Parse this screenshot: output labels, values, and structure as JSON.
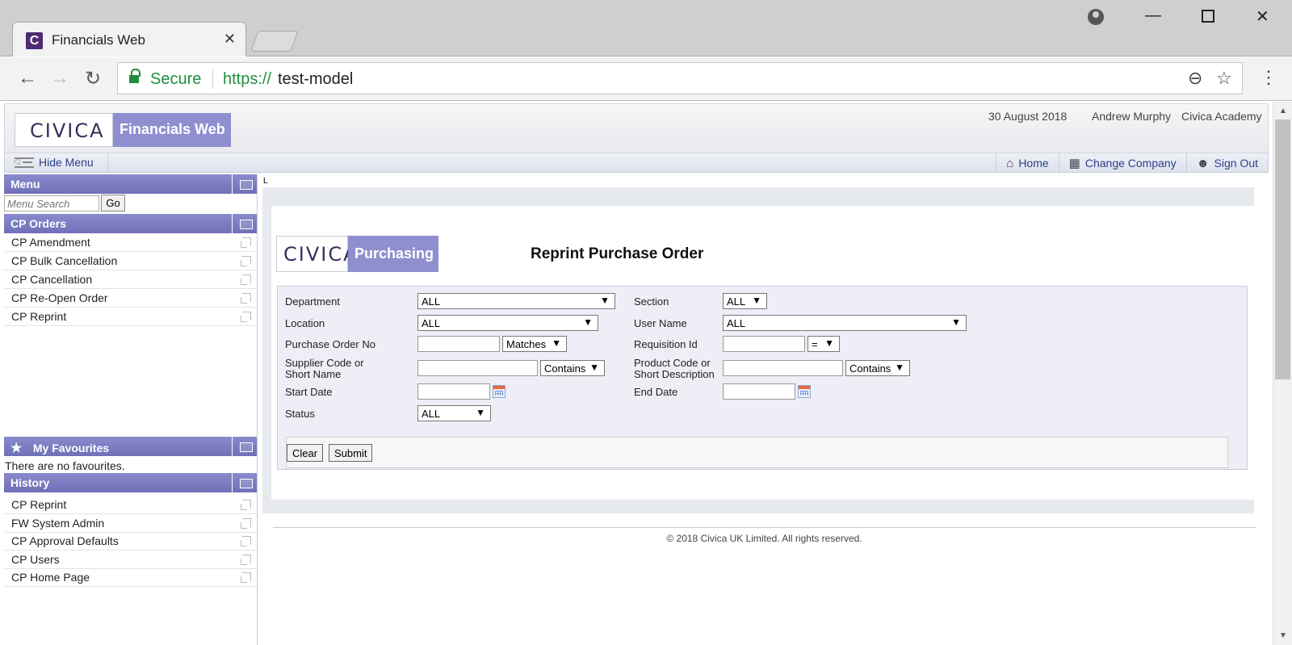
{
  "browser": {
    "tab_title": "Financials Web",
    "favicon_letter": "C",
    "tab_close": "✕",
    "secure_label": "Secure",
    "url_scheme": "https://",
    "url_host": "test-model"
  },
  "app": {
    "logo_word": "CIVICA",
    "product_name": "Financials Web",
    "date": "30 August 2018",
    "user": "Andrew Murphy",
    "company": "Civica Academy"
  },
  "toolbar": {
    "hide_menu": "Hide Menu",
    "home": "Home",
    "change_company": "Change Company",
    "sign_out": "Sign Out"
  },
  "sidebar": {
    "menu_title": "Menu",
    "search_placeholder": "Menu Search",
    "go_label": "Go",
    "orders_title": "CP Orders",
    "orders_items": [
      "CP Amendment",
      "CP Bulk Cancellation",
      "CP Cancellation",
      "CP Re-Open Order",
      "CP Reprint"
    ],
    "favourites_title": "My Favourites",
    "favourites_empty": "There are no favourites.",
    "history_title": "History",
    "history_items": [
      "CP Reprint",
      "FW System Admin",
      "CP Approval Defaults",
      "CP Users",
      "CP Home Page"
    ]
  },
  "main": {
    "corner_mark": "L",
    "logo_word": "CIVICA",
    "module_name": "Purchasing",
    "title": "Reprint Purchase Order",
    "form": {
      "department_label": "Department",
      "department_value": "ALL",
      "section_label": "Section",
      "section_value": "ALL",
      "location_label": "Location",
      "location_value": "ALL",
      "username_label": "User Name",
      "username_value": "ALL",
      "po_label": "Purchase Order No",
      "po_match": "Matches",
      "req_label": "Requisition Id",
      "req_match": "=",
      "supplier_label_1": "Supplier Code or",
      "supplier_label_2": "Short Name",
      "supplier_match": "Contains",
      "product_label_1": "Product Code or",
      "product_label_2": "Short Description",
      "product_match": "Contains",
      "start_label": "Start Date",
      "end_label": "End Date",
      "status_label": "Status",
      "status_value": "ALL"
    },
    "clear_label": "Clear",
    "submit_label": "Submit"
  },
  "footer": "© 2018 Civica UK Limited. All rights reserved.",
  "colors": {
    "accent": "#8f8fcf",
    "panel_header": "#7878bf",
    "link": "#2b3f8a",
    "secure_green": "#1e8e3e"
  }
}
